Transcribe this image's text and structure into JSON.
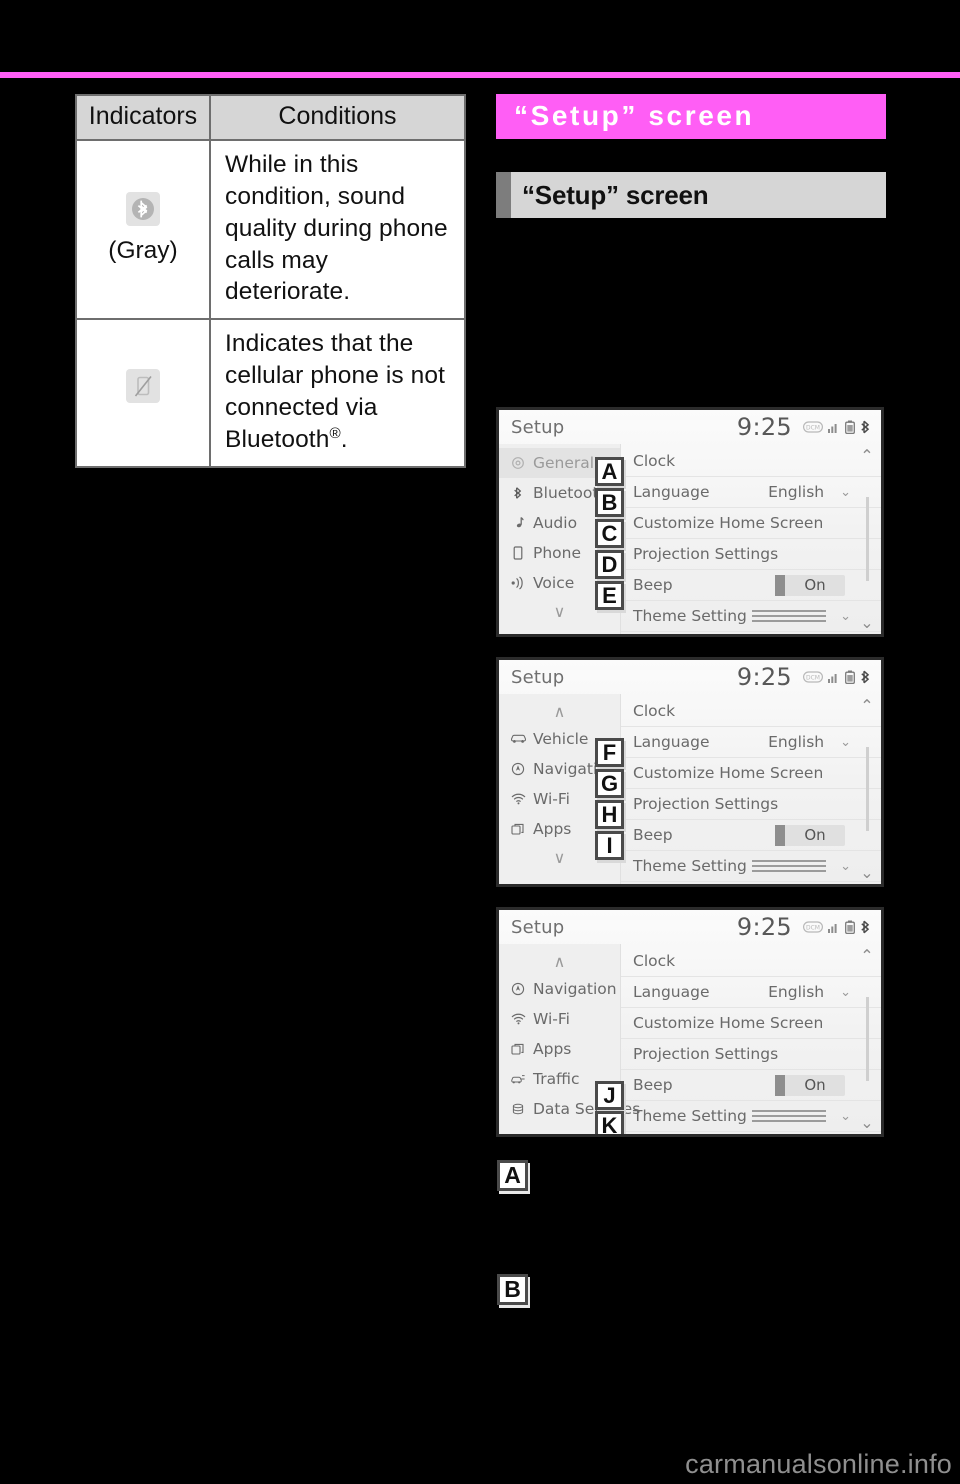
{
  "table": {
    "headers": [
      "Indicators",
      "Conditions"
    ],
    "rows": [
      {
        "icon": "bluetooth-icon",
        "icon_caption": "(Gray)",
        "condition": "While in this condition, sound quality during phone calls may deteriorate."
      },
      {
        "icon": "phone-disconnected-icon",
        "icon_caption": "",
        "condition_prefix": "Indicates that the cellular phone is not connected via Bluetooth",
        "condition_suffix": "."
      }
    ]
  },
  "chapter": {
    "title": "“Setup” screen"
  },
  "section": {
    "title": "“Setup” screen"
  },
  "screens": [
    {
      "id": "screen-1",
      "status": {
        "title": "Setup",
        "clock": "9:25"
      },
      "sidebar": [
        {
          "label": "General",
          "icon": "gear-icon",
          "active": true
        },
        {
          "label": "Bluetooth",
          "icon": "bluetooth-icon",
          "active": false
        },
        {
          "label": "Audio",
          "icon": "music-note-icon",
          "active": false
        },
        {
          "label": "Phone",
          "icon": "phone-icon",
          "active": false
        },
        {
          "label": "Voice",
          "icon": "voice-icon",
          "active": false
        }
      ],
      "sidebar_top_arrow": "",
      "sidebar_bottom_arrow": "∨",
      "rows": [
        {
          "label": "Clock",
          "value": "",
          "control": "none",
          "callout": "A"
        },
        {
          "label": "Language",
          "value": "English",
          "control": "chevron",
          "callout": "B"
        },
        {
          "label": "Customize Home Screen",
          "value": "",
          "control": "none",
          "callout": "C"
        },
        {
          "label": "Projection Settings",
          "value": "",
          "control": "none",
          "callout": "D"
        },
        {
          "label": "Beep",
          "value": "On",
          "control": "toggle",
          "callout": "E"
        },
        {
          "label": "Theme Setting",
          "value": "",
          "control": "theme",
          "callout": ""
        }
      ]
    },
    {
      "id": "screen-2",
      "status": {
        "title": "Setup",
        "clock": "9:25"
      },
      "sidebar": [
        {
          "label": "Vehicle",
          "icon": "car-icon",
          "active": false
        },
        {
          "label": "Navigation",
          "icon": "navigation-icon",
          "active": false
        },
        {
          "label": "Wi-Fi",
          "icon": "wifi-icon",
          "active": false
        },
        {
          "label": "Apps",
          "icon": "apps-icon",
          "active": false
        }
      ],
      "sidebar_top_arrow": "∧",
      "sidebar_bottom_arrow": "∨",
      "rows": [
        {
          "label": "Clock",
          "value": "",
          "control": "none",
          "callout": ""
        },
        {
          "label": "Language",
          "value": "English",
          "control": "chevron",
          "callout": "F"
        },
        {
          "label": "Customize Home Screen",
          "value": "",
          "control": "none",
          "callout": "G"
        },
        {
          "label": "Projection Settings",
          "value": "",
          "control": "none",
          "callout": "H"
        },
        {
          "label": "Beep",
          "value": "On",
          "control": "toggle",
          "callout": "I"
        },
        {
          "label": "Theme Setting",
          "value": "",
          "control": "theme",
          "callout": ""
        }
      ]
    },
    {
      "id": "screen-3",
      "status": {
        "title": "Setup",
        "clock": "9:25"
      },
      "sidebar": [
        {
          "label": "Navigation",
          "icon": "navigation-icon",
          "active": false
        },
        {
          "label": "Wi-Fi",
          "icon": "wifi-icon",
          "active": false
        },
        {
          "label": "Apps",
          "icon": "apps-icon",
          "active": false
        },
        {
          "label": "Traffic",
          "icon": "traffic-icon",
          "active": false
        },
        {
          "label": "Data Services",
          "icon": "data-services-icon",
          "active": false
        }
      ],
      "sidebar_top_arrow": "∧",
      "sidebar_bottom_arrow": "",
      "rows": [
        {
          "label": "Clock",
          "value": "",
          "control": "none",
          "callout": ""
        },
        {
          "label": "Language",
          "value": "English",
          "control": "chevron",
          "callout": ""
        },
        {
          "label": "Customize Home Screen",
          "value": "",
          "control": "none",
          "callout": ""
        },
        {
          "label": "Projection Settings",
          "value": "",
          "control": "none",
          "callout": ""
        },
        {
          "label": "Beep",
          "value": "On",
          "control": "toggle",
          "callout": "J"
        },
        {
          "label": "Theme Setting",
          "value": "",
          "control": "theme",
          "callout": "K"
        }
      ]
    }
  ],
  "item_markers": [
    {
      "letter": "A",
      "text": ""
    },
    {
      "letter": "B",
      "text": ""
    }
  ],
  "watermark": "carmanualsonline.info",
  "colors": {
    "accent": "#ff5ef5",
    "section_band": "#d6d6d6",
    "section_tab": "#7d7d7d",
    "page_background": "#000000",
    "table_header": "#d6d6d6"
  }
}
